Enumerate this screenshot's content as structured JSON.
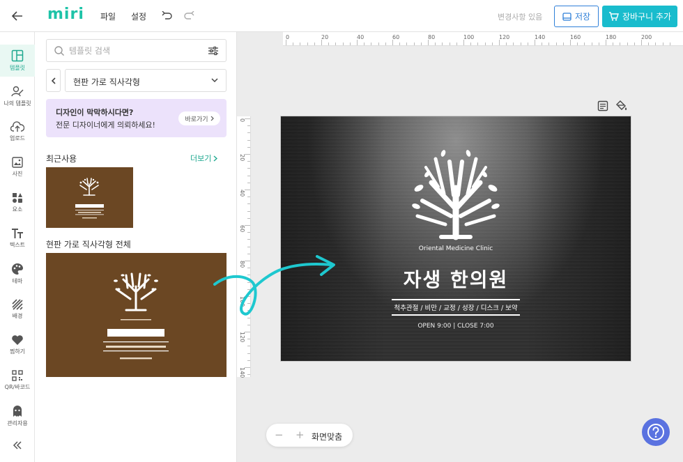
{
  "app": {
    "logo": "miri"
  },
  "menu": {
    "file": "파일",
    "settings": "설정"
  },
  "header": {
    "status": "변경사항 있음",
    "save_label": "저장",
    "cart_label": "장바구니 추가"
  },
  "nav": [
    {
      "label": "템플릿",
      "icon": "template-icon",
      "active": true
    },
    {
      "label": "나의 템플릿",
      "icon": "my-template-icon"
    },
    {
      "label": "업로드",
      "icon": "upload-icon"
    },
    {
      "label": "사진",
      "icon": "photo-icon"
    },
    {
      "label": "요소",
      "icon": "elements-icon"
    },
    {
      "label": "텍스트",
      "icon": "text-icon"
    },
    {
      "label": "테마",
      "icon": "palette-icon"
    },
    {
      "label": "배경",
      "icon": "background-icon"
    },
    {
      "label": "찜하기",
      "icon": "heart-icon"
    },
    {
      "label": "QR/바코드",
      "icon": "qr-icon"
    },
    {
      "label": "관리자용",
      "icon": "admin-icon"
    }
  ],
  "panel": {
    "search_placeholder": "템플릿 검색",
    "category": "현판 가로 직사각형",
    "promo_title": "디자인이 막막하시다면?",
    "promo_sub": "전문 디자이너에게 의뢰하세요!",
    "promo_button": "바로가기",
    "recent_title": "최근사용",
    "more_link": "더보기",
    "all_title": "현판 가로 직사각형 전체"
  },
  "design": {
    "subtitle": "Oriental Medicine Clinic",
    "title": "자생 한의원",
    "services": "척추관절 / 비만 / 교정 / 성장 / 디스크 / 보약",
    "hours": "OPEN 9:00 | CLOSE 7:00"
  },
  "ruler": {
    "h_ticks": [
      "0",
      "20",
      "40",
      "60",
      "80",
      "100",
      "120",
      "140",
      "160",
      "180",
      "200"
    ],
    "v_ticks": [
      "0",
      "20",
      "40",
      "60",
      "80",
      "100",
      "120",
      "140"
    ]
  },
  "zoom": {
    "minus": "−",
    "plus": "+",
    "fit_label": "화면맞춤"
  },
  "colors": {
    "brand": "#1ec3a8",
    "accent": "#19bccd",
    "template_brown": "#6b4723"
  }
}
